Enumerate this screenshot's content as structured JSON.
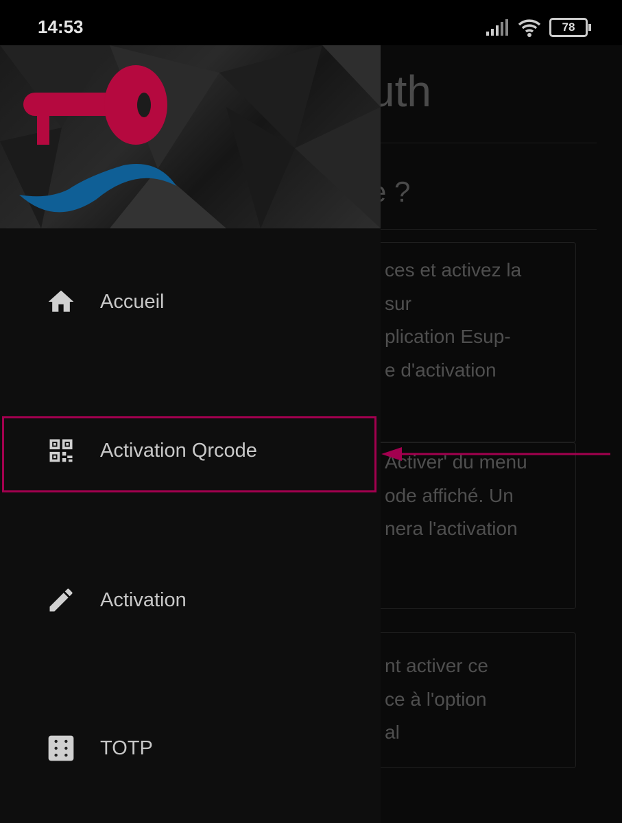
{
  "status_bar": {
    "time": "14:53",
    "battery": "78",
    "icons": [
      "signal-icon",
      "wifi-icon",
      "battery-icon"
    ]
  },
  "background_page": {
    "title": "uth",
    "heading": "e ?",
    "cards": [
      {
        "lines": [
          "ces et activez la",
          "sur",
          "plication Esup-",
          "e d'activation"
        ]
      },
      {
        "lines": [
          "Activer' du menu",
          "ode affiché. Un",
          "nera l'activation"
        ]
      },
      {
        "lines": [
          "nt activer ce",
          "ce à l'option",
          "al"
        ]
      }
    ]
  },
  "drawer": {
    "logo": "key-wave-logo",
    "items": [
      {
        "label": "Accueil",
        "icon": "home-icon"
      },
      {
        "label": "Activation Qrcode",
        "icon": "qrcode-icon",
        "highlighted": true
      },
      {
        "label": "Activation",
        "icon": "pencil-icon"
      },
      {
        "label": "TOTP",
        "icon": "dice-icon"
      }
    ]
  },
  "colors": {
    "highlight": "#a3004f",
    "key": "#b5093f",
    "wave": "#0f5f96"
  }
}
